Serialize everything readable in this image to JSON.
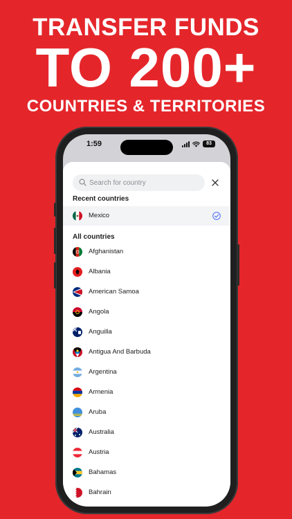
{
  "promo": {
    "line1": "TRANSFER FUNDS",
    "line2": "TO 200+",
    "line3": "COUNTRIES & TERRITORIES"
  },
  "statusbar": {
    "time": "1:59",
    "battery": "83"
  },
  "search": {
    "placeholder": "Search for country",
    "value": ""
  },
  "sections": {
    "recent_title": "Recent countries",
    "all_title": "All countries"
  },
  "recent": [
    {
      "name": "Mexico",
      "flag": "mexico-flag-icon",
      "selected": true
    }
  ],
  "countries": [
    {
      "name": "Afghanistan",
      "flag": "afghanistan-flag-icon"
    },
    {
      "name": "Albania",
      "flag": "albania-flag-icon"
    },
    {
      "name": "American Samoa",
      "flag": "american-samoa-flag-icon"
    },
    {
      "name": "Angola",
      "flag": "angola-flag-icon"
    },
    {
      "name": "Anguilla",
      "flag": "anguilla-flag-icon"
    },
    {
      "name": "Antigua And Barbuda",
      "flag": "antigua-and-barbuda-flag-icon"
    },
    {
      "name": "Argentina",
      "flag": "argentina-flag-icon"
    },
    {
      "name": "Armenia",
      "flag": "armenia-flag-icon"
    },
    {
      "name": "Aruba",
      "flag": "aruba-flag-icon"
    },
    {
      "name": "Australia",
      "flag": "australia-flag-icon"
    },
    {
      "name": "Austria",
      "flag": "austria-flag-icon"
    },
    {
      "name": "Bahamas",
      "flag": "bahamas-flag-icon"
    },
    {
      "name": "Bahrain",
      "flag": "bahrain-flag-icon"
    }
  ],
  "colors": {
    "background": "#E4262B",
    "check": "#4A6CF7"
  }
}
